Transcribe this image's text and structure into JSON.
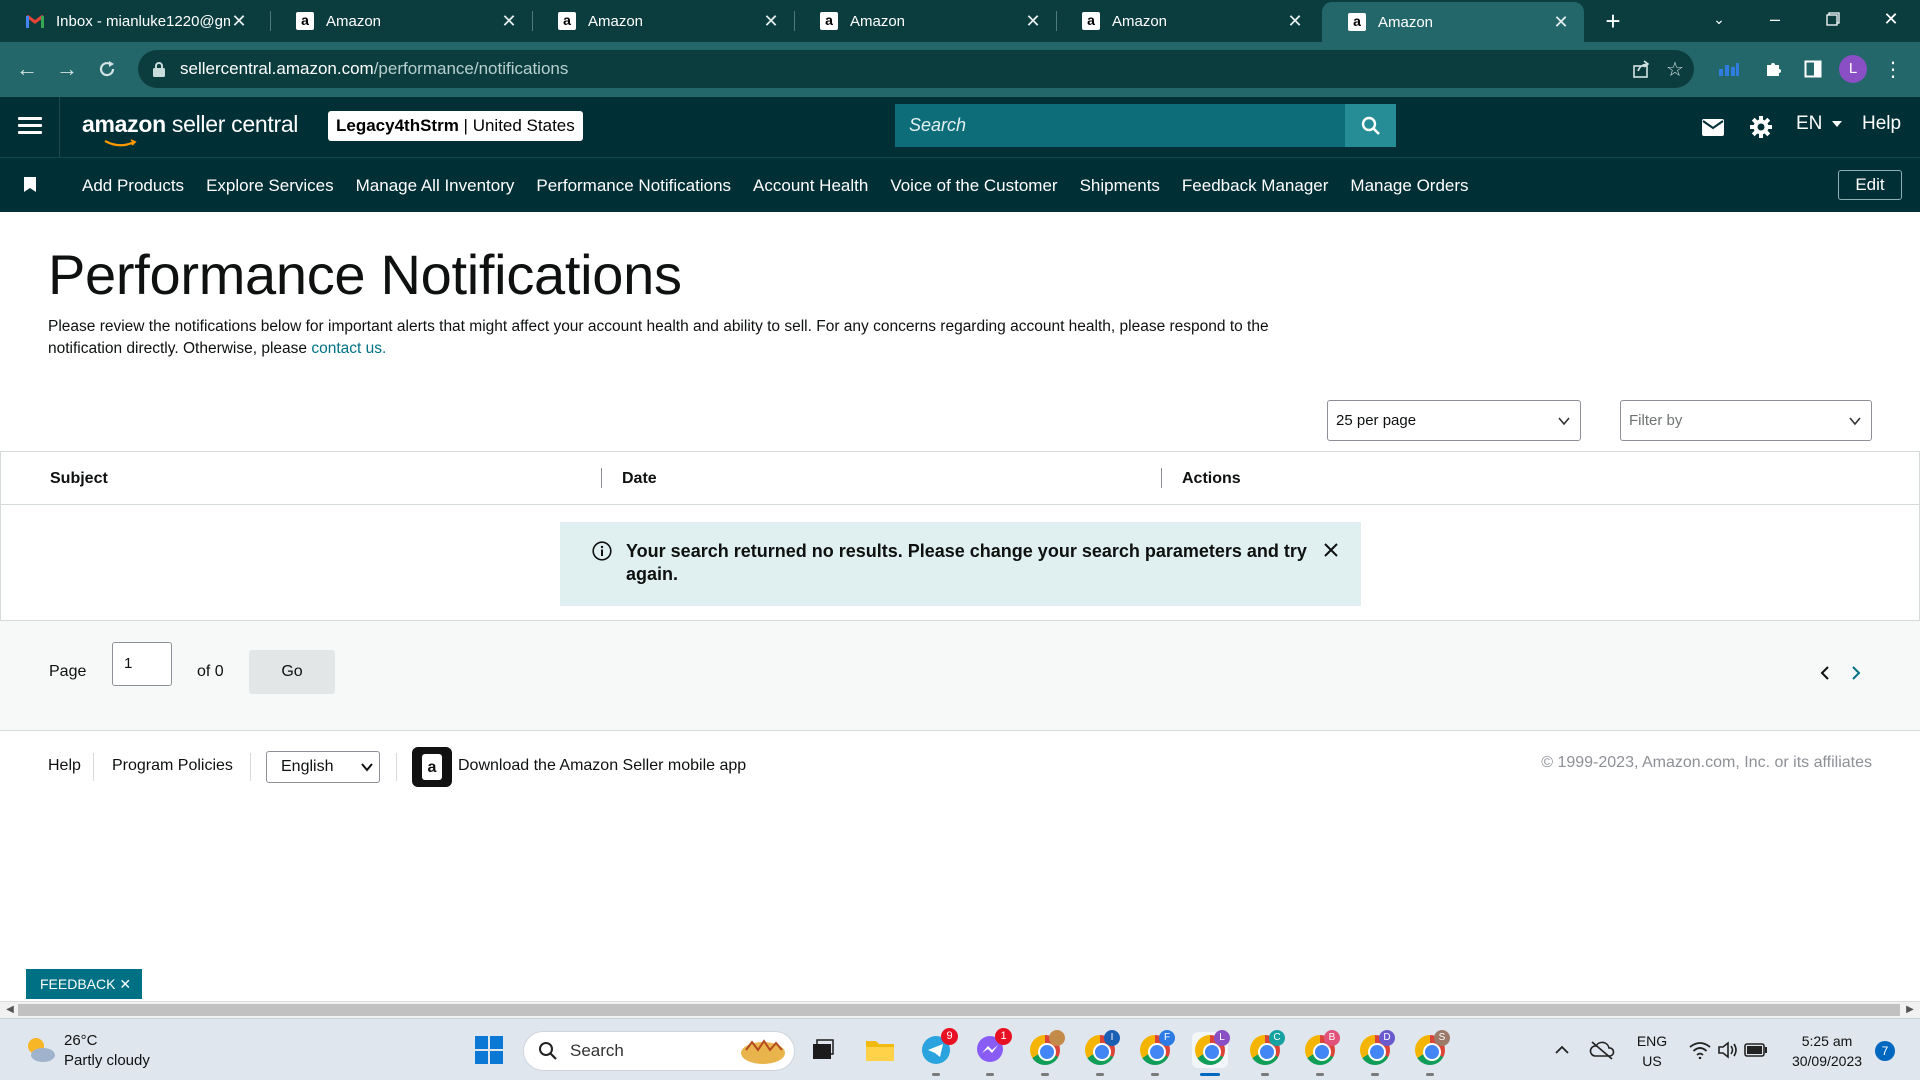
{
  "browser": {
    "tabs": [
      {
        "title": "Inbox - mianluke1220@gm",
        "icon": "gmail-icon"
      },
      {
        "title": "Amazon",
        "icon": "amazon-icon"
      },
      {
        "title": "Amazon",
        "icon": "amazon-icon"
      },
      {
        "title": "Amazon",
        "icon": "amazon-icon"
      },
      {
        "title": "Amazon",
        "icon": "amazon-icon"
      },
      {
        "title": "Amazon",
        "icon": "amazon-icon"
      }
    ],
    "url_host": "sellercentral.amazon.com",
    "url_path": "/performance/notifications",
    "profile_initial": "L"
  },
  "header": {
    "logo_bold": "amazon",
    "logo_rest": " seller central",
    "account_name": "Legacy4thStrm",
    "account_region": " | United States",
    "search_placeholder": "Search",
    "language": "EN",
    "help": "Help"
  },
  "nav": {
    "items": [
      "Add Products",
      "Explore Services",
      "Manage All Inventory",
      "Performance Notifications",
      "Account Health",
      "Voice of the Customer",
      "Shipments",
      "Feedback Manager",
      "Manage Orders"
    ],
    "edit": "Edit"
  },
  "main": {
    "title": "Performance Notifications",
    "description": "Please review the notifications below for important alerts that might affect your account health and ability to sell. For any concerns regarding account health, please respond to the notification directly. Otherwise, please ",
    "contact_link": "contact us.",
    "per_page": "25 per page",
    "filter_placeholder": "Filter by",
    "columns": [
      "Subject",
      "Date",
      "Actions"
    ],
    "alert": "Your search returned no results. Please change your search parameters and try again.",
    "pager": {
      "page_label": "Page",
      "page_value": "1",
      "of_label": "of 0",
      "go": "Go"
    }
  },
  "footer": {
    "help": "Help",
    "program_policies": "Program Policies",
    "language": "English",
    "app_text": "Download the Amazon Seller mobile app",
    "copyright": "© 1999-2023, Amazon.com, Inc. or its affiliates"
  },
  "feedback": "FEEDBACK ✕",
  "taskbar": {
    "temperature": "26°C",
    "weather": "Partly cloudy",
    "search": "Search",
    "lang_top": "ENG",
    "lang_bottom": "US",
    "time": "5:25 am",
    "date": "30/09/2023",
    "notifications": "7",
    "telegram_badge": "9",
    "messenger_badge": "1",
    "chrome_profiles": [
      "",
      "I",
      "F",
      "L",
      "C",
      "B",
      "D",
      "S"
    ]
  },
  "colors": {
    "header_bg": "#002f36",
    "search_bg": "#0d6d78",
    "link": "#007185",
    "alert_bg": "#e0f0f1"
  }
}
